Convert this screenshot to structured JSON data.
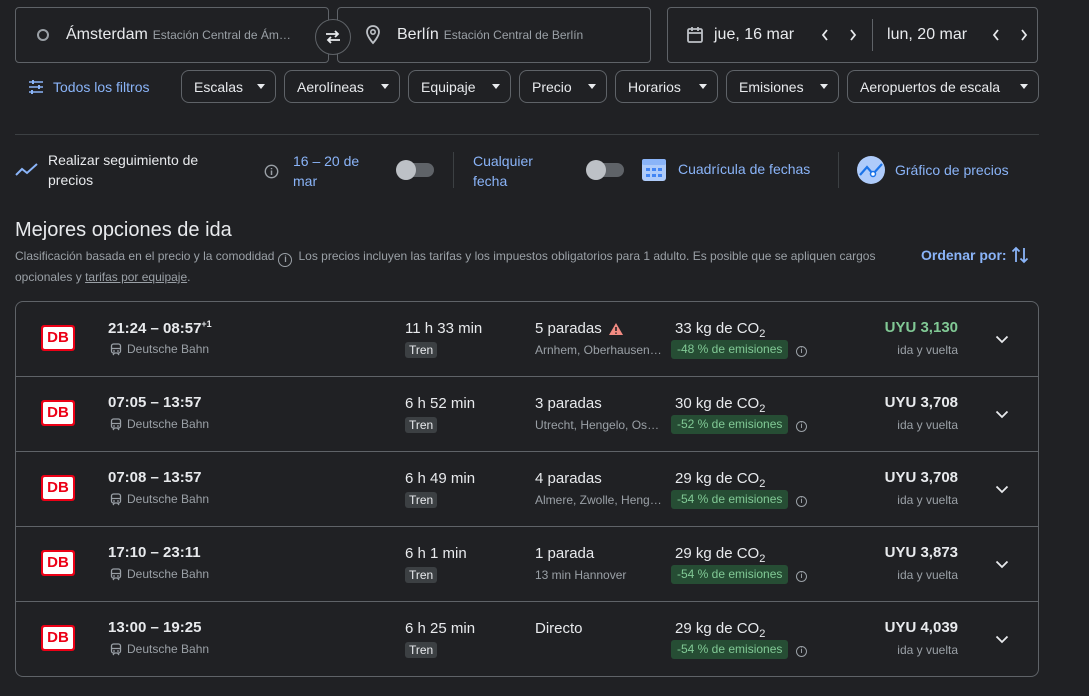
{
  "search": {
    "origin_city": "Ámsterdam",
    "origin_station": "Estación Central de Ám…",
    "destination_city": "Berlín",
    "destination_station": "Estación Central de Berlín",
    "depart_date": "jue, 16 mar",
    "return_date": "lun, 20 mar"
  },
  "filters": {
    "all_label": "Todos los filtros",
    "chips": [
      "Escalas",
      "Aerolíneas",
      "Equipaje",
      "Precio",
      "Horarios",
      "Emisiones",
      "Aeropuertos de escala"
    ]
  },
  "tracking": {
    "label": "Realizar seguimiento de precios",
    "range_label": "16 – 20 de mar",
    "any_date_label": "Cualquier fecha",
    "date_grid_label": "Cuadrícula de fechas",
    "price_graph_label": "Gráfico de precios"
  },
  "results": {
    "title": "Mejores opciones de ida",
    "ranking_note": "Clasificación basada en el precio y la comodidad",
    "price_note": "Los precios incluyen las tarifas y los impuestos obligatorios para 1 adulto. Es posible que se apliquen cargos opcionales y",
    "baggage_link": "tarifas por equipaje",
    "period": ".",
    "sort_label": "Ordenar por:",
    "rows": [
      {
        "logo": "DB",
        "times": "21:24 – 08:57",
        "day_offset": "+1",
        "carrier": "Deutsche Bahn",
        "duration": "11 h 33 min",
        "mode": "Tren",
        "stops": "5 paradas",
        "stops_detail": "Arnhem, Oberhausen,…",
        "co2_value": "33 kg de CO",
        "co2_sub": "2",
        "emissions": "-48 % de emisiones",
        "price": "UYU 3,130",
        "price_type": "ida y vuelta",
        "warning": true,
        "price_color": "#81c995"
      },
      {
        "logo": "DB",
        "times": "07:05 – 13:57",
        "day_offset": "",
        "carrier": "Deutsche Bahn",
        "duration": "6 h 52 min",
        "mode": "Tren",
        "stops": "3 paradas",
        "stops_detail": "Utrecht, Hengelo, Osn…",
        "co2_value": "30 kg de CO",
        "co2_sub": "2",
        "emissions": "-52 % de emisiones",
        "price": "UYU 3,708",
        "price_type": "ida y vuelta",
        "warning": false
      },
      {
        "logo": "DB",
        "times": "07:08 – 13:57",
        "day_offset": "",
        "carrier": "Deutsche Bahn",
        "duration": "6 h 49 min",
        "mode": "Tren",
        "stops": "4 paradas",
        "stops_detail": "Almere, Zwolle, Heng…",
        "co2_value": "29 kg de CO",
        "co2_sub": "2",
        "emissions": "-54 % de emisiones",
        "price": "UYU 3,708",
        "price_type": "ida y vuelta",
        "warning": false
      },
      {
        "logo": "DB",
        "times": "17:10 – 23:11",
        "day_offset": "",
        "carrier": "Deutsche Bahn",
        "duration": "6 h 1 min",
        "mode": "Tren",
        "stops": "1 parada",
        "stops_detail": "13 min Hannover",
        "co2_value": "29 kg de CO",
        "co2_sub": "2",
        "emissions": "-54 % de emisiones",
        "price": "UYU 3,873",
        "price_type": "ida y vuelta",
        "warning": false
      },
      {
        "logo": "DB",
        "times": "13:00 – 19:25",
        "day_offset": "",
        "carrier": "Deutsche Bahn",
        "duration": "6 h 25 min",
        "mode": "Tren",
        "stops": "Directo",
        "stops_detail": "",
        "co2_value": "29 kg de CO",
        "co2_sub": "2",
        "emissions": "-54 % de emisiones",
        "price": "UYU 4,039",
        "price_type": "ida y vuelta",
        "warning": false
      }
    ]
  },
  "colors": {
    "accent": "#8ab4f8",
    "background": "#202124",
    "good_price": "#81c995",
    "emissions_bg": "#264d34",
    "warning": "#f28b82",
    "db_red": "#ec0016"
  }
}
